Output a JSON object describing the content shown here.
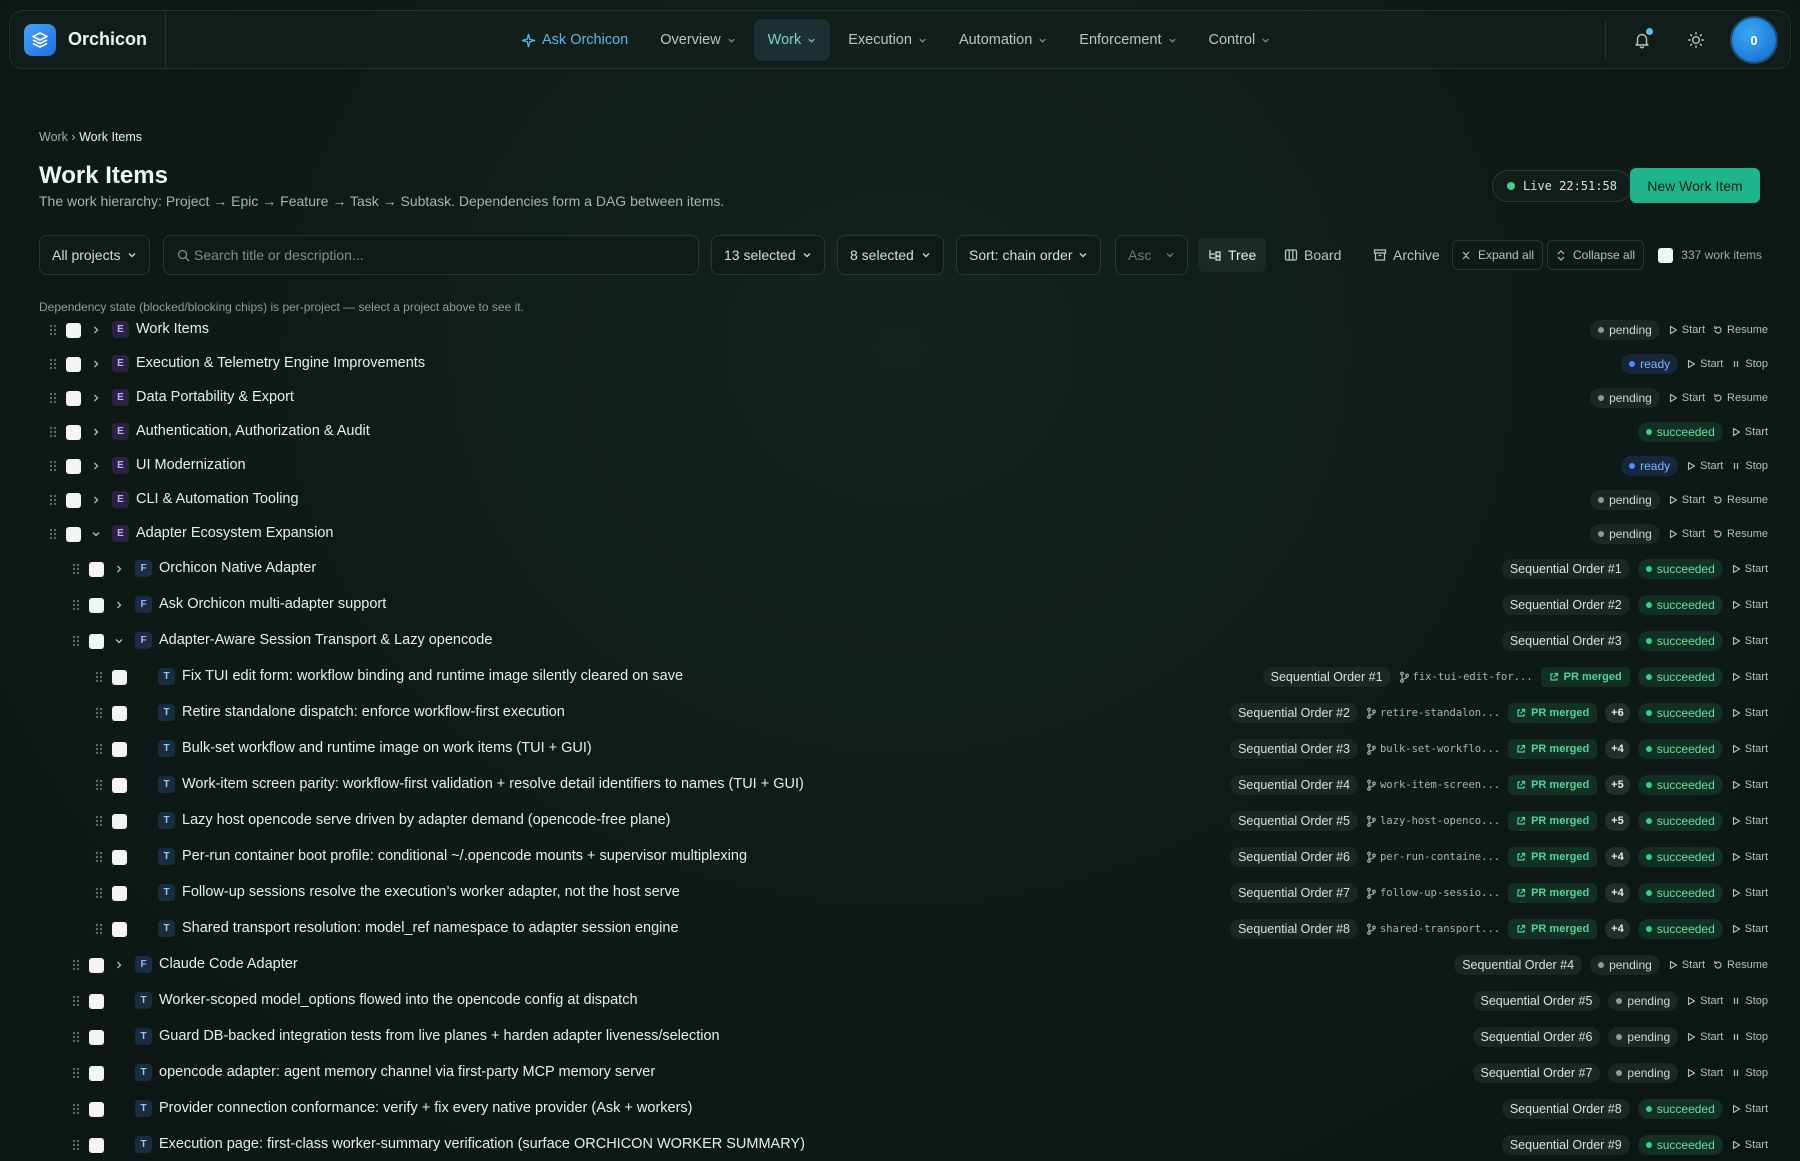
{
  "app": {
    "name": "Orchicon"
  },
  "nav": {
    "ask": "Ask Orchicon",
    "items": [
      "Overview",
      "Work",
      "Execution",
      "Automation",
      "Enforcement",
      "Control"
    ],
    "active": "Work"
  },
  "user": {
    "avatar": "0"
  },
  "breadcrumb": {
    "parent": "Work",
    "current": "Work Items"
  },
  "page": {
    "title": "Work Items",
    "subtitle": "The work hierarchy: Project → Epic → Feature → Task → Subtask. Dependencies form a DAG between items.",
    "live": "Live 22:51:58",
    "new_button": "New Work Item"
  },
  "toolbar": {
    "project": "All projects",
    "search_placeholder": "Search title or description...",
    "filter1": "13 selected",
    "filter2": "8 selected",
    "sort": "Sort: chain order",
    "order": "Asc",
    "views": [
      "Tree",
      "Board",
      "Archive"
    ],
    "expand_all": "Expand all",
    "collapse_all": "Collapse all",
    "count": "337 work items"
  },
  "note": "Dependency state (blocked/blocking chips) is per-project — select a project above to see it.",
  "rows": [
    {
      "level": 0,
      "chev": "right",
      "type": "E",
      "title": "Work Items",
      "status": "pending",
      "actions": [
        "Start",
        "Resume"
      ]
    },
    {
      "level": 0,
      "chev": "right",
      "type": "E",
      "title": "Execution & Telemetry Engine Improvements",
      "status": "ready",
      "actions": [
        "Start",
        "Stop"
      ]
    },
    {
      "level": 0,
      "chev": "right",
      "type": "E",
      "title": "Data Portability & Export",
      "status": "pending",
      "actions": [
        "Start",
        "Resume"
      ]
    },
    {
      "level": 0,
      "chev": "right",
      "type": "E",
      "title": "Authentication, Authorization & Audit",
      "status": "succeeded",
      "actions": [
        "Start"
      ]
    },
    {
      "level": 0,
      "chev": "right",
      "type": "E",
      "title": "UI Modernization",
      "status": "ready",
      "actions": [
        "Start",
        "Stop"
      ]
    },
    {
      "level": 0,
      "chev": "right",
      "type": "E",
      "title": "CLI & Automation Tooling",
      "status": "pending",
      "actions": [
        "Start",
        "Resume"
      ]
    },
    {
      "level": 0,
      "chev": "down",
      "type": "E",
      "title": "Adapter Ecosystem Expansion",
      "status": "pending",
      "actions": [
        "Start",
        "Resume"
      ]
    },
    {
      "level": 1,
      "chev": "right",
      "type": "F",
      "title": "Orchicon Native Adapter",
      "seq": "Sequential Order #1",
      "status": "succeeded",
      "actions": [
        "Start"
      ]
    },
    {
      "level": 1,
      "chev": "right",
      "type": "F",
      "title": "Ask Orchicon multi-adapter support",
      "seq": "Sequential Order #2",
      "status": "succeeded",
      "actions": [
        "Start"
      ]
    },
    {
      "level": 1,
      "chev": "down",
      "type": "F",
      "title": "Adapter-Aware Session Transport & Lazy opencode",
      "seq": "Sequential Order #3",
      "status": "succeeded",
      "actions": [
        "Start"
      ]
    },
    {
      "level": 2,
      "type": "T",
      "title": "Fix TUI edit form: workflow binding and runtime image silently cleared on save",
      "seq": "Sequential Order #1",
      "branch": "fix-tui-edit-for...",
      "pr": "PR merged",
      "status": "succeeded",
      "actions": [
        "Start"
      ]
    },
    {
      "level": 2,
      "type": "T",
      "title": "Retire standalone dispatch: enforce workflow-first execution",
      "seq": "Sequential Order #2",
      "branch": "retire-standalon...",
      "pr": "PR merged",
      "plus": "+6",
      "status": "succeeded",
      "actions": [
        "Start"
      ]
    },
    {
      "level": 2,
      "type": "T",
      "title": "Bulk-set workflow and runtime image on work items (TUI + GUI)",
      "seq": "Sequential Order #3",
      "branch": "bulk-set-workflo...",
      "pr": "PR merged",
      "plus": "+4",
      "status": "succeeded",
      "actions": [
        "Start"
      ]
    },
    {
      "level": 2,
      "type": "T",
      "title": "Work-item screen parity: workflow-first validation + resolve detail identifiers to names (TUI + GUI)",
      "seq": "Sequential Order #4",
      "branch": "work-item-screen...",
      "pr": "PR merged",
      "plus": "+5",
      "status": "succeeded",
      "actions": [
        "Start"
      ]
    },
    {
      "level": 2,
      "type": "T",
      "title": "Lazy host opencode serve driven by adapter demand (opencode-free plane)",
      "seq": "Sequential Order #5",
      "branch": "lazy-host-openco...",
      "pr": "PR merged",
      "plus": "+5",
      "status": "succeeded",
      "actions": [
        "Start"
      ]
    },
    {
      "level": 2,
      "type": "T",
      "title": "Per-run container boot profile: conditional ~/.opencode mounts + supervisor multiplexing",
      "seq": "Sequential Order #6",
      "branch": "per-run-containe...",
      "pr": "PR merged",
      "plus": "+4",
      "status": "succeeded",
      "actions": [
        "Start"
      ]
    },
    {
      "level": 2,
      "type": "T",
      "title": "Follow-up sessions resolve the execution’s worker adapter, not the host serve",
      "seq": "Sequential Order #7",
      "branch": "follow-up-sessio...",
      "pr": "PR merged",
      "plus": "+4",
      "status": "succeeded",
      "actions": [
        "Start"
      ]
    },
    {
      "level": 2,
      "type": "T",
      "title": "Shared transport resolution: model_ref namespace to adapter session engine",
      "seq": "Sequential Order #8",
      "branch": "shared-transport...",
      "pr": "PR merged",
      "plus": "+4",
      "status": "succeeded",
      "actions": [
        "Start"
      ]
    },
    {
      "level": 1,
      "chev": "right",
      "type": "F",
      "title": "Claude Code Adapter",
      "seq": "Sequential Order #4",
      "status": "pending",
      "actions": [
        "Start",
        "Resume"
      ]
    },
    {
      "level": 1,
      "type": "T",
      "title": "Worker-scoped model_options flowed into the opencode config at dispatch",
      "seq": "Sequential Order #5",
      "status": "pending",
      "actions": [
        "Start",
        "Stop"
      ]
    },
    {
      "level": 1,
      "type": "T",
      "title": "Guard DB-backed integration tests from live planes + harden adapter liveness/selection",
      "seq": "Sequential Order #6",
      "status": "pending",
      "actions": [
        "Start",
        "Stop"
      ]
    },
    {
      "level": 1,
      "type": "T",
      "title": "opencode adapter: agent memory channel via first-party MCP memory server",
      "seq": "Sequential Order #7",
      "status": "pending",
      "actions": [
        "Start",
        "Stop"
      ]
    },
    {
      "level": 1,
      "type": "T",
      "title": "Provider connection conformance: verify + fix every native provider (Ask + workers)",
      "seq": "Sequential Order #8",
      "status": "succeeded",
      "actions": [
        "Start"
      ]
    },
    {
      "level": 1,
      "type": "T",
      "title": "Execution page: first-class worker-summary verification (surface ORCHICON WORKER SUMMARY)",
      "seq": "Sequential Order #9",
      "status": "succeeded",
      "actions": [
        "Start"
      ]
    }
  ]
}
